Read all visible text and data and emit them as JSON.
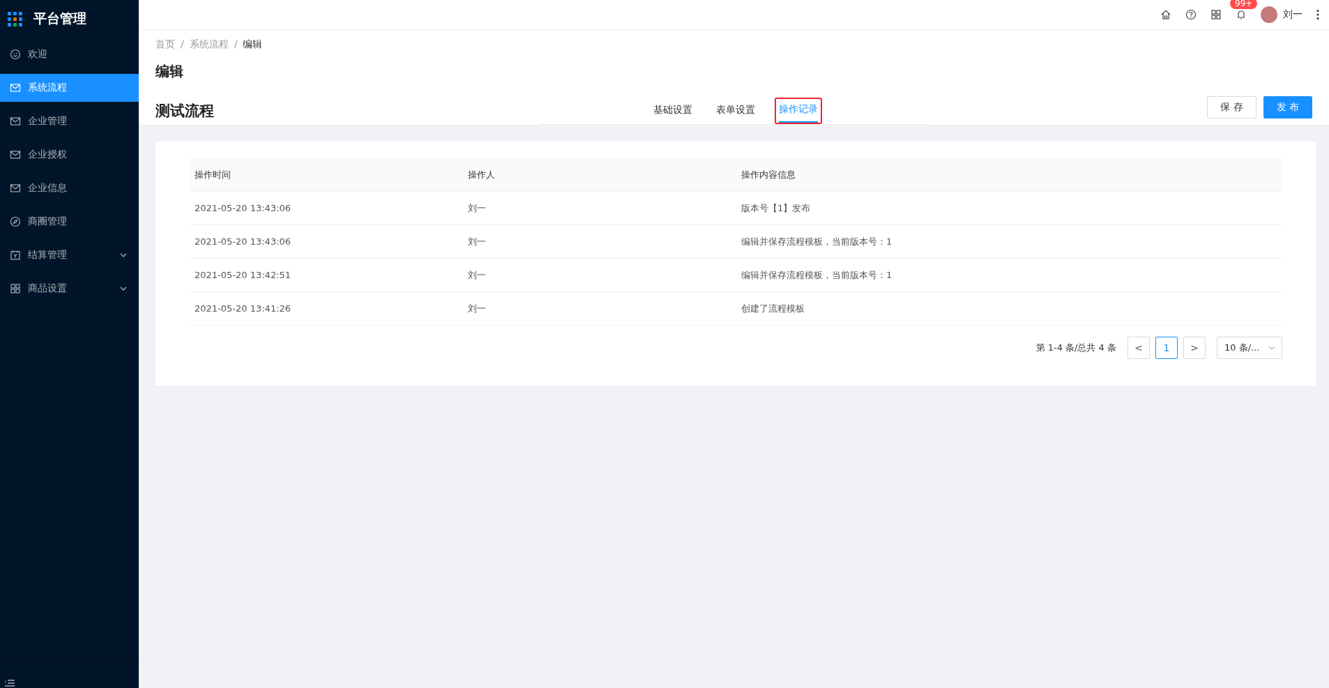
{
  "app": {
    "title": "平台管理"
  },
  "sidebar": {
    "items": [
      {
        "label": "欢迎",
        "kind": "smile",
        "selected": false,
        "expandable": false
      },
      {
        "label": "系统流程",
        "kind": "mail",
        "selected": true,
        "expandable": false
      },
      {
        "label": "企业管理",
        "kind": "mail",
        "selected": false,
        "expandable": false
      },
      {
        "label": "企业授权",
        "kind": "mail",
        "selected": false,
        "expandable": false
      },
      {
        "label": "企业信息",
        "kind": "mail",
        "selected": false,
        "expandable": false
      },
      {
        "label": "商圈管理",
        "kind": "compass",
        "selected": false,
        "expandable": false
      },
      {
        "label": "结算管理",
        "kind": "calendar",
        "selected": false,
        "expandable": true
      },
      {
        "label": "商品设置",
        "kind": "grid",
        "selected": false,
        "expandable": true
      }
    ]
  },
  "header": {
    "notification_badge": "99+",
    "user_name": "刘一"
  },
  "breadcrumb": [
    {
      "label": "首页"
    },
    {
      "separator": "/",
      "label": "系统流程"
    },
    {
      "separator": "/",
      "label": "编辑"
    }
  ],
  "page_title": "编辑",
  "flow_title": "测试流程",
  "tabs": [
    {
      "label": "基础设置",
      "selected": false,
      "highlighted": false
    },
    {
      "label": "表单设置",
      "selected": false,
      "highlighted": false
    },
    {
      "label": "操作记录",
      "selected": true,
      "highlighted": true
    }
  ],
  "buttons": [
    {
      "label": "保 存",
      "kind": "default"
    },
    {
      "label": "发 布",
      "kind": "primary"
    }
  ],
  "table": {
    "columns": [
      "操作时间",
      "操作人",
      "操作内容信息"
    ],
    "rows": [
      [
        "2021-05-20 13:43:06",
        "刘一",
        "版本号【1】发布"
      ],
      [
        "2021-05-20 13:43:06",
        "刘一",
        "编辑并保存流程模板，当前版本号：1"
      ],
      [
        "2021-05-20 13:42:51",
        "刘一",
        "编辑并保存流程模板，当前版本号：1"
      ],
      [
        "2021-05-20 13:41:26",
        "刘一",
        "创建了流程模板"
      ]
    ]
  },
  "pagination": {
    "summary": "第 1-4 条/总共 4 条",
    "prev": "<",
    "pages": [
      {
        "label": "1",
        "selected": true
      }
    ],
    "next": ">",
    "page_size": "10 条/..."
  }
}
